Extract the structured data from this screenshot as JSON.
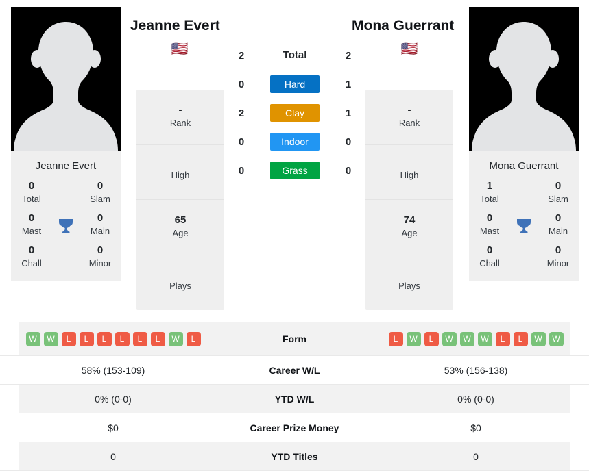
{
  "players": {
    "left": {
      "name": "Jeanne Evert",
      "flag": "🇺🇸",
      "flag_name": "flag-usa",
      "rank": "-",
      "rank_label": "Rank",
      "high": "",
      "high_label": "High",
      "age": "65",
      "age_label": "Age",
      "plays": "",
      "plays_label": "Plays",
      "titles": [
        {
          "label": "Total",
          "value": "0"
        },
        {
          "label": "Slam",
          "value": "0"
        },
        {
          "label": "Mast",
          "value": "0"
        },
        {
          "label": "Main",
          "value": "0"
        },
        {
          "label": "Chall",
          "value": "0"
        },
        {
          "label": "Minor",
          "value": "0"
        }
      ],
      "form": [
        "W",
        "W",
        "L",
        "L",
        "L",
        "L",
        "L",
        "L",
        "W",
        "L"
      ],
      "career_wl": "58% (153-109)",
      "ytd_wl": "0% (0-0)",
      "career_prize_money": "$0",
      "ytd_titles": "0"
    },
    "right": {
      "name": "Mona Guerrant",
      "flag": "🇺🇸",
      "flag_name": "flag-usa",
      "rank": "-",
      "rank_label": "Rank",
      "high": "",
      "high_label": "High",
      "age": "74",
      "age_label": "Age",
      "plays": "",
      "plays_label": "Plays",
      "titles": [
        {
          "label": "Total",
          "value": "1"
        },
        {
          "label": "Slam",
          "value": "0"
        },
        {
          "label": "Mast",
          "value": "0"
        },
        {
          "label": "Main",
          "value": "0"
        },
        {
          "label": "Chall",
          "value": "0"
        },
        {
          "label": "Minor",
          "value": "0"
        }
      ],
      "form": [
        "L",
        "W",
        "L",
        "W",
        "W",
        "W",
        "L",
        "L",
        "W",
        "W"
      ],
      "career_wl": "53% (156-138)",
      "ytd_wl": "0% (0-0)",
      "career_prize_money": "$0",
      "ytd_titles": "0"
    }
  },
  "head_to_head": {
    "rows": [
      {
        "label": "Total",
        "left": "2",
        "right": "2",
        "color": "",
        "plain": true
      },
      {
        "label": "Hard",
        "left": "0",
        "right": "1",
        "color": "#0571c4",
        "plain": false
      },
      {
        "label": "Clay",
        "left": "2",
        "right": "1",
        "color": "#e09300",
        "plain": false
      },
      {
        "label": "Indoor",
        "left": "0",
        "right": "0",
        "color": "#2196f3",
        "plain": false
      },
      {
        "label": "Grass",
        "left": "0",
        "right": "0",
        "color": "#00a443",
        "plain": false
      }
    ]
  },
  "comparison": {
    "rows": [
      {
        "label": "Form",
        "key": "form",
        "type": "form"
      },
      {
        "label": "Career W/L",
        "key": "career_wl",
        "type": "text"
      },
      {
        "label": "YTD W/L",
        "key": "ytd_wl",
        "type": "text"
      },
      {
        "label": "Career Prize Money",
        "key": "career_prize_money",
        "type": "text"
      },
      {
        "label": "YTD Titles",
        "key": "ytd_titles",
        "type": "text"
      }
    ]
  },
  "icons": {
    "trophy": "trophy-icon",
    "avatar": "avatar-placeholder"
  }
}
